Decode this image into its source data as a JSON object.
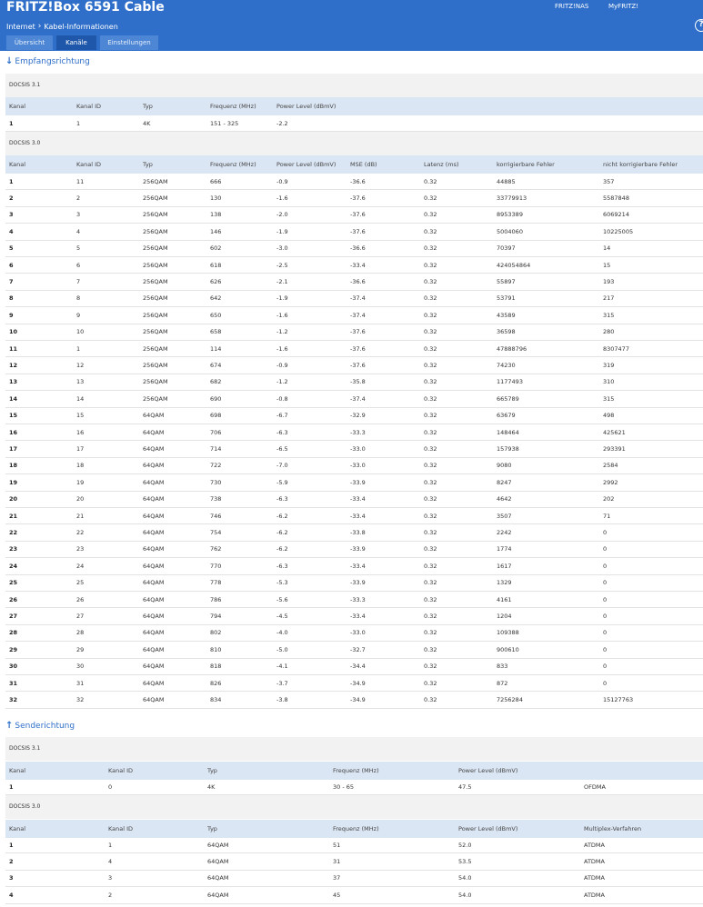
{
  "header": {
    "brand": "FRITZ!Box 6591 Cable",
    "links": [
      "FRITZ!NAS",
      "MyFRITZ!"
    ],
    "help_icon": "question-circle-icon",
    "help_glyph": "?",
    "breadcrumb": [
      "Internet",
      "Kabel-Informationen"
    ],
    "breadcrumb_icon": "chevron-right-icon",
    "breadcrumb_glyph": "›"
  },
  "tabs": [
    {
      "label": "Übersicht",
      "active": false
    },
    {
      "label": "Kanäle",
      "active": true
    },
    {
      "label": "Einstellungen",
      "active": false
    }
  ],
  "colors": {
    "accent": "#2f6fc9",
    "tab_active": "#1f58aa",
    "table_header": "#dbe6f4",
    "section_bg": "#f2f2f2"
  },
  "downstream": {
    "title": "Empfangsrichtung",
    "icon": "arrow-down-icon",
    "glyph": "↓",
    "d31": {
      "label": "DOCSIS 3.1",
      "headers": [
        "Kanal",
        "Kanal ID",
        "Typ",
        "Frequenz (MHz)",
        "Power Level (dBmV)"
      ],
      "rows": [
        [
          "1",
          "1",
          "4K",
          "151 - 325",
          "-2.2"
        ]
      ]
    },
    "d30": {
      "label": "DOCSIS 3.0",
      "headers": [
        "Kanal",
        "Kanal ID",
        "Typ",
        "Frequenz (MHz)",
        "Power Level (dBmV)",
        "MSE (dB)",
        "Latenz (ms)",
        "korrigierbare Fehler",
        "nicht korrigierbare Fehler"
      ],
      "rows": [
        [
          "1",
          "11",
          "256QAM",
          "666",
          "-0.9",
          "-36.6",
          "0.32",
          "44885",
          "357"
        ],
        [
          "2",
          "2",
          "256QAM",
          "130",
          "-1.6",
          "-37.6",
          "0.32",
          "33779913",
          "5587848"
        ],
        [
          "3",
          "3",
          "256QAM",
          "138",
          "-2.0",
          "-37.6",
          "0.32",
          "8953389",
          "6069214"
        ],
        [
          "4",
          "4",
          "256QAM",
          "146",
          "-1.9",
          "-37.6",
          "0.32",
          "5004060",
          "10225005"
        ],
        [
          "5",
          "5",
          "256QAM",
          "602",
          "-3.0",
          "-36.6",
          "0.32",
          "70397",
          "14"
        ],
        [
          "6",
          "6",
          "256QAM",
          "618",
          "-2.5",
          "-33.4",
          "0.32",
          "424054864",
          "15"
        ],
        [
          "7",
          "7",
          "256QAM",
          "626",
          "-2.1",
          "-36.6",
          "0.32",
          "55897",
          "193"
        ],
        [
          "8",
          "8",
          "256QAM",
          "642",
          "-1.9",
          "-37.4",
          "0.32",
          "53791",
          "217"
        ],
        [
          "9",
          "9",
          "256QAM",
          "650",
          "-1.6",
          "-37.4",
          "0.32",
          "43589",
          "315"
        ],
        [
          "10",
          "10",
          "256QAM",
          "658",
          "-1.2",
          "-37.6",
          "0.32",
          "36598",
          "280"
        ],
        [
          "11",
          "1",
          "256QAM",
          "114",
          "-1.6",
          "-37.6",
          "0.32",
          "47888796",
          "8307477"
        ],
        [
          "12",
          "12",
          "256QAM",
          "674",
          "-0.9",
          "-37.6",
          "0.32",
          "74230",
          "319"
        ],
        [
          "13",
          "13",
          "256QAM",
          "682",
          "-1.2",
          "-35.8",
          "0.32",
          "1177493",
          "310"
        ],
        [
          "14",
          "14",
          "256QAM",
          "690",
          "-0.8",
          "-37.4",
          "0.32",
          "665789",
          "315"
        ],
        [
          "15",
          "15",
          "64QAM",
          "698",
          "-6.7",
          "-32.9",
          "0.32",
          "63679",
          "498"
        ],
        [
          "16",
          "16",
          "64QAM",
          "706",
          "-6.3",
          "-33.3",
          "0.32",
          "148464",
          "425621"
        ],
        [
          "17",
          "17",
          "64QAM",
          "714",
          "-6.5",
          "-33.0",
          "0.32",
          "157938",
          "293391"
        ],
        [
          "18",
          "18",
          "64QAM",
          "722",
          "-7.0",
          "-33.0",
          "0.32",
          "9080",
          "2584"
        ],
        [
          "19",
          "19",
          "64QAM",
          "730",
          "-5.9",
          "-33.9",
          "0.32",
          "8247",
          "2992"
        ],
        [
          "20",
          "20",
          "64QAM",
          "738",
          "-6.3",
          "-33.4",
          "0.32",
          "4642",
          "202"
        ],
        [
          "21",
          "21",
          "64QAM",
          "746",
          "-6.2",
          "-33.4",
          "0.32",
          "3507",
          "71"
        ],
        [
          "22",
          "22",
          "64QAM",
          "754",
          "-6.2",
          "-33.8",
          "0.32",
          "2242",
          "0"
        ],
        [
          "23",
          "23",
          "64QAM",
          "762",
          "-6.2",
          "-33.9",
          "0.32",
          "1774",
          "0"
        ],
        [
          "24",
          "24",
          "64QAM",
          "770",
          "-6.3",
          "-33.4",
          "0.32",
          "1617",
          "0"
        ],
        [
          "25",
          "25",
          "64QAM",
          "778",
          "-5.3",
          "-33.9",
          "0.32",
          "1329",
          "0"
        ],
        [
          "26",
          "26",
          "64QAM",
          "786",
          "-5.6",
          "-33.3",
          "0.32",
          "4161",
          "0"
        ],
        [
          "27",
          "27",
          "64QAM",
          "794",
          "-4.5",
          "-33.4",
          "0.32",
          "1204",
          "0"
        ],
        [
          "28",
          "28",
          "64QAM",
          "802",
          "-4.0",
          "-33.0",
          "0.32",
          "109388",
          "0"
        ],
        [
          "29",
          "29",
          "64QAM",
          "810",
          "-5.0",
          "-32.7",
          "0.32",
          "900610",
          "0"
        ],
        [
          "30",
          "30",
          "64QAM",
          "818",
          "-4.1",
          "-34.4",
          "0.32",
          "833",
          "0"
        ],
        [
          "31",
          "31",
          "64QAM",
          "826",
          "-3.7",
          "-34.9",
          "0.32",
          "872",
          "0"
        ],
        [
          "32",
          "32",
          "64QAM",
          "834",
          "-3.8",
          "-34.9",
          "0.32",
          "7256284",
          "15127763"
        ]
      ]
    }
  },
  "upstream": {
    "title": "Senderichtung",
    "icon": "arrow-up-icon",
    "glyph": "↑",
    "d31": {
      "label": "DOCSIS 3.1",
      "headers": [
        "Kanal",
        "Kanal ID",
        "Typ",
        "Frequenz (MHz)",
        "Power Level (dBmV)",
        ""
      ],
      "rows": [
        [
          "1",
          "0",
          "4K",
          "30 - 65",
          "47.5",
          "OFDMA"
        ]
      ]
    },
    "d30": {
      "label": "DOCSIS 3.0",
      "headers": [
        "Kanal",
        "Kanal ID",
        "Typ",
        "Frequenz (MHz)",
        "Power Level (dBmV)",
        "Multiplex-Verfahren"
      ],
      "rows": [
        [
          "1",
          "1",
          "64QAM",
          "51",
          "52.0",
          "ATDMA"
        ],
        [
          "2",
          "4",
          "64QAM",
          "31",
          "53.5",
          "ATDMA"
        ],
        [
          "3",
          "3",
          "64QAM",
          "37",
          "54.0",
          "ATDMA"
        ],
        [
          "4",
          "2",
          "64QAM",
          "45",
          "54.0",
          "ATDMA"
        ]
      ]
    }
  }
}
